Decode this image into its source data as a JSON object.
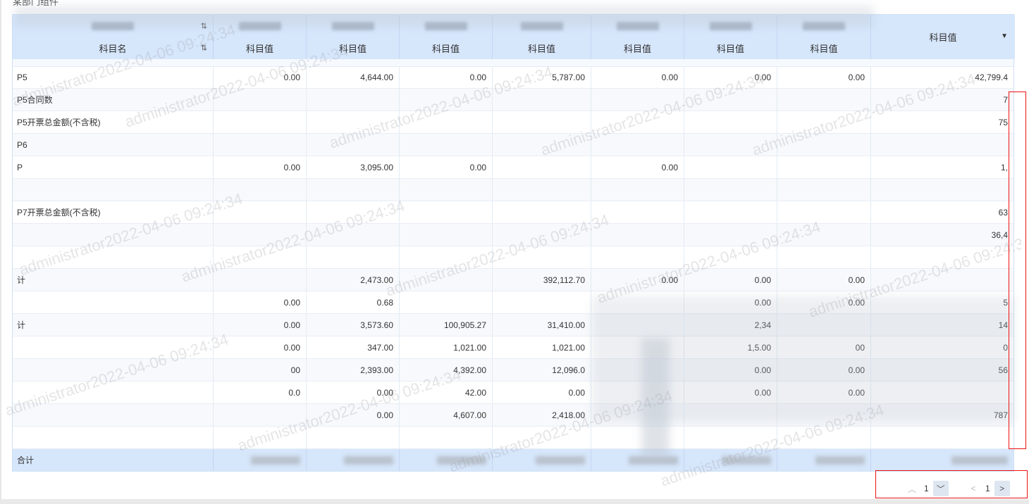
{
  "page": {
    "title": "某部门组件"
  },
  "table": {
    "header_row2": [
      "科目名",
      "科目值",
      "科目值",
      "科目值",
      "科目值",
      "科目值",
      "科目值",
      "科目值"
    ],
    "header_row1_first": "",
    "last_header": "科目值",
    "rows": [
      {
        "name": "P5",
        "v": [
          "0.00",
          "4,644.00",
          "0.00",
          "5,787.00",
          "0.00",
          "0.00",
          "0.00",
          "42,799.4"
        ]
      },
      {
        "name": "P5合同数",
        "v": [
          "",
          "",
          "",
          "",
          "",
          "",
          "",
          "7"
        ]
      },
      {
        "name": "P5开票总金额(不含税)",
        "v": [
          "",
          "",
          "",
          "",
          "",
          "",
          "",
          "75"
        ]
      },
      {
        "name": "P6",
        "v": [
          "",
          "",
          "",
          "",
          "",
          "",
          "",
          ""
        ]
      },
      {
        "name": "P",
        "v": [
          "0.00",
          "3,095.00",
          "0.00",
          "",
          "0.00",
          "",
          "",
          "1,"
        ]
      },
      {
        "name": "",
        "v": [
          "",
          "",
          "",
          "",
          "",
          "",
          "",
          ""
        ]
      },
      {
        "name": "P7开票总金额(不含税)",
        "v": [
          "",
          "",
          "",
          "",
          "",
          "",
          "",
          "63"
        ]
      },
      {
        "name": "",
        "v": [
          "",
          "",
          "",
          "",
          "",
          "",
          "",
          "36,4"
        ]
      },
      {
        "name": "",
        "v": [
          "",
          "",
          "",
          "",
          "",
          "",
          "",
          ""
        ]
      },
      {
        "name": "计",
        "v": [
          "",
          "2,473.00",
          "",
          "392,112.70",
          "0.00",
          "0.00",
          "0.00",
          ""
        ]
      },
      {
        "name": "",
        "v": [
          "0.00",
          "0.68",
          "",
          "",
          "",
          "0.00",
          "0.00",
          "5"
        ]
      },
      {
        "name": "计",
        "v": [
          "0.00",
          "3,573.60",
          "100,905.27",
          "31,410.00",
          "",
          "2,34",
          "",
          "14"
        ]
      },
      {
        "name": "",
        "v": [
          "0.00",
          "347.00",
          "1,021.00",
          "1,021.00",
          "",
          "1,5.00",
          "00",
          "0"
        ]
      },
      {
        "name": "",
        "v": [
          "00",
          "2,393.00",
          "4,392.00",
          "12,096.0",
          "",
          "0.00",
          "0.00",
          "56"
        ]
      },
      {
        "name": "",
        "v": [
          "0.0",
          "0.00",
          "42.00",
          "0.00",
          "",
          "0.00",
          "0.00",
          ""
        ]
      },
      {
        "name": "",
        "v": [
          "",
          "0.00",
          "4,607.00",
          "2,418.00",
          "",
          "",
          "",
          "787"
        ]
      },
      {
        "name": "",
        "v": [
          "",
          "",
          "",
          "",
          "",
          "",
          "",
          ""
        ]
      }
    ],
    "total_label": "合计"
  },
  "watermark": "administrator2022-04-06 09:24:34",
  "pager": {
    "row_page": "1",
    "col_page": "1"
  },
  "colors": {
    "header_bg": "#d6e6fb",
    "accent_red": "#ee1111"
  }
}
